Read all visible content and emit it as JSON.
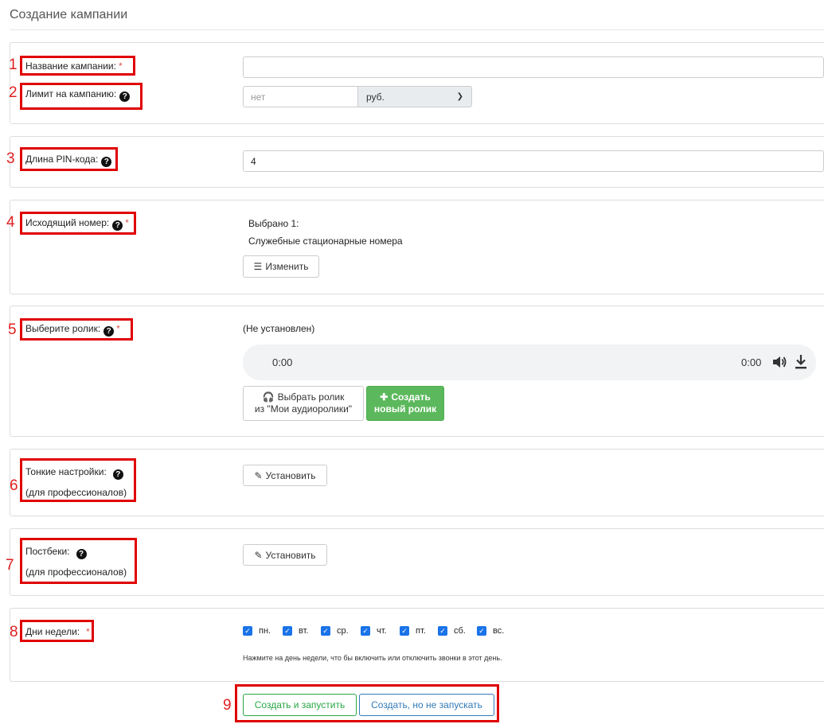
{
  "page": {
    "title": "Создание кампании"
  },
  "markers": [
    "1",
    "2",
    "3",
    "4",
    "5",
    "6",
    "7",
    "8",
    "9"
  ],
  "fields": {
    "campaign_name": {
      "label": "Название кампании:",
      "required": "*",
      "value": ""
    },
    "campaign_limit": {
      "label": "Лимит на кампанию:",
      "placeholder": "нет",
      "currency": "руб."
    },
    "pin_length": {
      "label": "Длина PIN-кода:",
      "value": "4"
    },
    "outgoing_number": {
      "label": "Исходящий номер:",
      "required": "*",
      "selected_count": "Выбрано 1:",
      "selected_value": "Служебные стационарные номера",
      "change_button": "Изменить"
    },
    "audio_clip": {
      "label": "Выберите ролик:",
      "required": "*",
      "status": "(Не установлен)",
      "current_time": "0:00",
      "duration": "0:00",
      "choose_button_line1": "Выбрать ролик",
      "choose_button_line2": "из \"Мои аудиоролики\"",
      "create_button_line1": "Создать",
      "create_button_line2": "новый ролик"
    },
    "fine_settings": {
      "label": "Тонкие настройки:",
      "sublabel": "(для профессионалов)",
      "button": "Установить"
    },
    "postbacks": {
      "label": "Постбеки:",
      "sublabel": "(для профессионалов)",
      "button": "Установить"
    },
    "weekdays": {
      "label": "Дни недели:",
      "required": "*",
      "days": [
        "пн.",
        "вт.",
        "ср.",
        "чт.",
        "пт.",
        "сб.",
        "вс."
      ],
      "hint": "Нажмите на день недели, что бы включить или отключить звонки в этот день."
    }
  },
  "actions": {
    "create_and_start": "Создать и запустить",
    "create_no_start": "Создать, но не запускать"
  },
  "icons": {
    "help": "question-circle-icon",
    "list": "list-icon",
    "headphones": "headphones-icon",
    "plus": "plus-icon",
    "pencil": "pencil-icon",
    "volume": "volume-icon",
    "download": "download-icon"
  },
  "colors": {
    "annotation": "#e00000",
    "green": "#5cb85c",
    "blue": "#337ab7",
    "checkbox": "#1a73e8"
  }
}
